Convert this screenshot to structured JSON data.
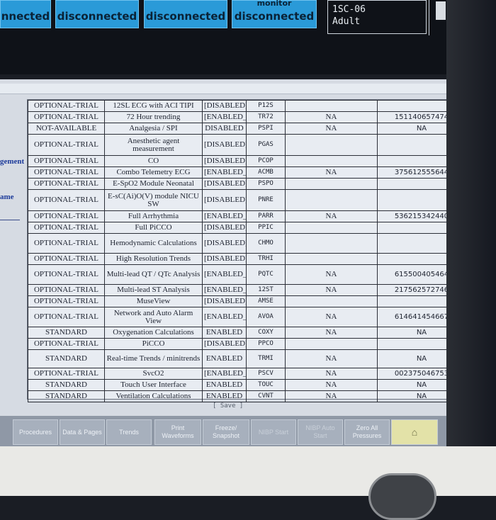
{
  "topbar": {
    "buttons": [
      {
        "label": "nnected"
      },
      {
        "label": "disconnected"
      },
      {
        "label": "disconnected"
      },
      {
        "top": "monitor",
        "label": "disconnected"
      }
    ],
    "patient": {
      "bed": "1SC-06",
      "type": "Adult"
    }
  },
  "left_labels": {
    "label1": "gement",
    "label2": "ame"
  },
  "table": {
    "rows": [
      [
        "OPTIONAL-TRIAL",
        "12SL ECG with ACI TIPI",
        "[DISABLED]",
        "P12S",
        "",
        ""
      ],
      [
        "OPTIONAL-TRIAL",
        "72 Hour trending",
        "[ENABLED_]",
        "TR72",
        "NA",
        "151140657474"
      ],
      [
        "NOT-AVAILABLE",
        "Analgesia / SPI",
        "DISABLED",
        "PSPI",
        "NA",
        "NA"
      ],
      [
        "OPTIONAL-TRIAL",
        "Anesthetic agent measurement",
        "[DISABLED]",
        "PGAS",
        "",
        ""
      ],
      [
        "OPTIONAL-TRIAL",
        "CO",
        "[DISABLED]",
        "PCOP",
        "",
        ""
      ],
      [
        "OPTIONAL-TRIAL",
        "Combo Telemetry ECG",
        "[ENABLED_]",
        "ACMB",
        "NA",
        "375612555644"
      ],
      [
        "OPTIONAL-TRIAL",
        "E-SpO2 Module Neonatal",
        "[DISABLED]",
        "PSPO",
        "",
        ""
      ],
      [
        "OPTIONAL-TRIAL",
        "E-sC(Ai)O(V) module NICU SW",
        "[DISABLED]",
        "PNRE",
        "",
        ""
      ],
      [
        "OPTIONAL-TRIAL",
        "Full Arrhythmia",
        "[ENABLED_]",
        "PARR",
        "NA",
        "536215342440"
      ],
      [
        "OPTIONAL-TRIAL",
        "Full PiCCO",
        "[DISABLED]",
        "PPIC",
        "",
        ""
      ],
      [
        "OPTIONAL-TRIAL",
        "Hemodynamic Calculations",
        "[DISABLED]",
        "CHMO",
        "",
        ""
      ],
      [
        "OPTIONAL-TRIAL",
        "High Resolution Trends",
        "[DISABLED]",
        "TRHI",
        "",
        ""
      ],
      [
        "OPTIONAL-TRIAL",
        "Multi-lead QT / QTc Analysis",
        "[ENABLED_]",
        "PQTC",
        "NA",
        "615500405464"
      ],
      [
        "OPTIONAL-TRIAL",
        "Multi-lead ST Analysis",
        "[ENABLED_]",
        "12ST",
        "NA",
        "217562572746"
      ],
      [
        "OPTIONAL-TRIAL",
        "MuseView",
        "[DISABLED]",
        "AMSE",
        "",
        ""
      ],
      [
        "OPTIONAL-TRIAL",
        "Network and Auto Alarm View",
        "[ENABLED_]",
        "AVOA",
        "NA",
        "614641454667"
      ],
      [
        "STANDARD",
        "Oxygenation Calculations",
        "ENABLED",
        "COXY",
        "NA",
        "NA"
      ],
      [
        "OPTIONAL-TRIAL",
        "PiCCO",
        "[DISABLED]",
        "PPCO",
        "",
        ""
      ],
      [
        "STANDARD",
        "Real-time Trends / minitrends",
        "ENABLED",
        "TRMI",
        "NA",
        "NA"
      ],
      [
        "OPTIONAL-TRIAL",
        "SvcO2",
        "[ENABLED_]",
        "PSCV",
        "NA",
        "002375046753"
      ],
      [
        "STANDARD",
        "Touch User Interface",
        "ENABLED",
        "TOUC",
        "NA",
        "NA"
      ],
      [
        "STANDARD",
        "Ventilation Calculations",
        "ENABLED",
        "CVNT",
        "NA",
        "NA"
      ]
    ]
  },
  "save_label": "[ Save ]",
  "bottombar": {
    "buttons": [
      {
        "label": "Procedures"
      },
      {
        "label": "Data & Pages"
      },
      {
        "label": "Trends"
      },
      {
        "label": "Print Waveforms"
      },
      {
        "label": "Freeze/ Snapshot"
      },
      {
        "label": "NIBP Start"
      },
      {
        "label": "NIBP Auto Start"
      },
      {
        "label": "Zero All Pressures"
      },
      {
        "label": "⌂"
      }
    ]
  }
}
